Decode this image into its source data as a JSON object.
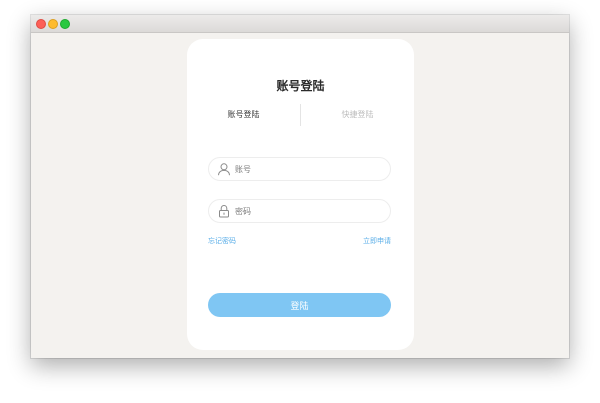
{
  "window": {
    "title": ""
  },
  "login": {
    "title": "账号登陆",
    "tabs": [
      {
        "label": "账号登陆",
        "active": true
      },
      {
        "label": "快捷登陆",
        "active": false
      }
    ],
    "username": {
      "value": "",
      "placeholder": "账号",
      "icon": "user-icon"
    },
    "password": {
      "value": "",
      "placeholder": "密码",
      "icon": "lock-icon"
    },
    "forgot_label": "忘记密码",
    "register_label": "立即申请",
    "submit_label": "登陆"
  },
  "colors": {
    "accent": "#7fc6f3",
    "link": "#5aaee8",
    "background": "#f4f2ef",
    "card": "#ffffff"
  }
}
